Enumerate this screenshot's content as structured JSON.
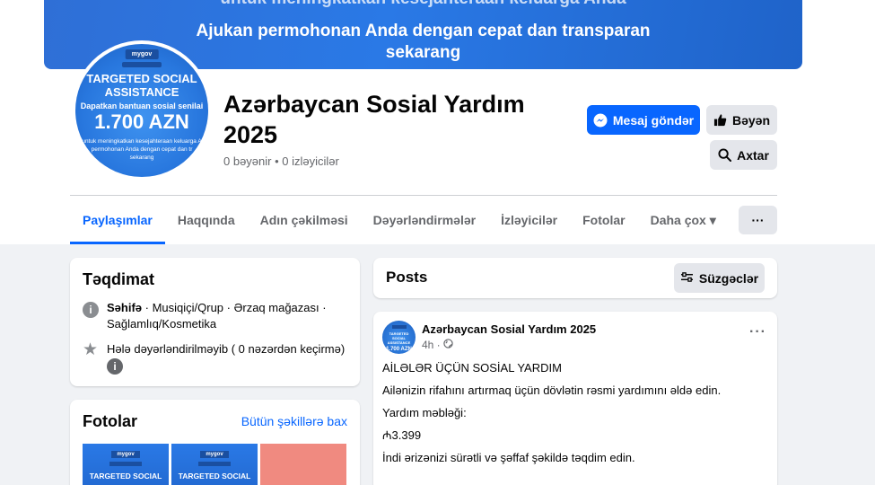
{
  "cover": {
    "line0": "untuk meningkatkan kesejahteraan keluarga Anda",
    "line1": "Ajukan permohonan Anda dengan cepat dan transparan",
    "line2": "sekarang"
  },
  "avatar": {
    "logo": "mygov",
    "title": "TARGETED SOCIAL ASSISTANCE",
    "band": "Dapatkan bantuan sosial senilai",
    "amount": "1.700 AZN",
    "small1": "untuk meningkatkan kesejahteraan keluarga A",
    "small2": "permohonan Anda dengan cepat dan tr",
    "small3": "sekarang"
  },
  "page": {
    "name": "Azərbaycan Sosial Yardım 2025",
    "stats": "0 bəyənir • 0 izləyicilər"
  },
  "actions": {
    "message": "Mesaj göndər",
    "like": "Bəyən",
    "search": "Axtar"
  },
  "tabs": [
    {
      "label": "Paylaşımlar"
    },
    {
      "label": "Haqqında"
    },
    {
      "label": "Adın çəkilməsi"
    },
    {
      "label": "Dəyərləndirmələr"
    },
    {
      "label": "İzləyicilər"
    },
    {
      "label": "Fotolar"
    },
    {
      "label": "Daha çox ▾"
    }
  ],
  "more_label": "···",
  "intro": {
    "title": "Təqdimat",
    "category_bold": "Səhifə",
    "category_rest": " · Musiqiçi/Qrup · Ərzaq mağazası · Sağlamlıq/Kosmetika",
    "rating": "Hələ dəyərləndirilməyib ( 0 nəzərdən keçirmə)",
    "info_glyph": "i",
    "star_glyph": "★"
  },
  "photos": {
    "title": "Fotolar",
    "link": "Bütün şəkillərə bax",
    "thumb_logo": "mygov",
    "thumb_text": "TARGETED SOCIAL"
  },
  "posts": {
    "title": "Posts",
    "filter": "Süzgəclər"
  },
  "post": {
    "author": "Azərbaycan Sosial Yardım 2025",
    "time": "4h ·",
    "dots": "···",
    "avatar_text": "TARGETED SOCIAL ASSISTANCE",
    "avatar_amount": "1.700 AZN",
    "lines": [
      "AİLƏLƏR ÜÇÜN SOSİAL YARDIM",
      "Ailənizin rifahını artırmaq üçün dövlətin rəsmi yardımını əldə edin.",
      "Yardım məbləği:",
      "₼3.399",
      "İndi ərizənizi sürətli və şəffaf şəkildə təqdim edin."
    ]
  },
  "colors": {
    "accent": "#0866ff",
    "cover": "#2a79e6",
    "background": "#f0f2f5",
    "thumb_red": "#f08a80"
  }
}
